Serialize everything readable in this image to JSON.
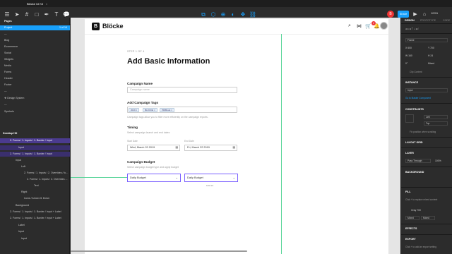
{
  "window": {
    "tab_title": "Blöcke UI Kit",
    "tab_close": "×"
  },
  "toolbar": {
    "user_initial": "B",
    "share_label": "Share",
    "zoom_label": "100%"
  },
  "left": {
    "pages_header": "Pages",
    "pages": [
      "Project",
      "—",
      "Blog",
      "Ecommerce",
      "Social",
      "Widgets",
      "Media",
      "Forms",
      "Header",
      "Footer",
      "—",
      "❖ Design System",
      "—",
      "Symbols"
    ],
    "project_count": "1 of 14",
    "layers": [
      "Desktop HD",
      "2. Forms / 1. Inputs / 1. Border / Input",
      "Input",
      "2. Forms / 1. Inputs / 1. Border / Input",
      "Input",
      "Left",
      "2. Forms / 1. Inputs / 2. Overrides / Ic...",
      "2. Forms / 1. Inputs / 2. Overrides ...",
      "Text",
      "Right",
      "Icons / Arrow #1 Down",
      "Background",
      "2. Forms / 1. Inputs / 1. Border / Input + Label",
      "2. Forms / 1. Inputs / 1. Border / Input + Label",
      "Label",
      "Input",
      "Input"
    ]
  },
  "app": {
    "brand": "Blöcke",
    "logo_letter": "B",
    "cart_count": "2",
    "step": "STEP 1 OF 4",
    "title": "Add Basic Information",
    "campaign_name_label": "Campaign Name",
    "campaign_name_placeholder": "Campaign name",
    "tags_label": "Add Campaign Tags",
    "tags": [
      "2019 ×",
      "BLOCKE ×",
      "PRIBLLE ×"
    ],
    "tags_hint": "Campaign tags allow you to filter more efficiently on the campaign reports.",
    "timing_label": "Timing",
    "timing_hint": "Select campaign launch and end dates",
    "start_label": "Start Date",
    "start_value": "Wed, March 20 2019",
    "end_label": "End Date",
    "end_value": "Fri, March 22 2019",
    "budget_label": "Campaign Budget",
    "budget_hint": "Select campaign budget type and apply budget",
    "budget_left": "Daily Budget",
    "budget_right": "Daily Budget",
    "dimension": "160×24"
  },
  "right": {
    "tabs": [
      "DESIGN",
      "PROTOTYPE",
      "CODE"
    ],
    "frame_label": "Frame",
    "x": "X 600",
    "y": "Y 700",
    "w": "W 160",
    "h": "H 24",
    "r": "0°",
    "mixed": "Mixed",
    "clip": "Clip Content",
    "instance_label": "INSTANCE",
    "instance_value": "Input",
    "goto_master": "Go to Master Component",
    "constraints_label": "CONSTRAINTS",
    "c_left": "Left",
    "c_top": "Top",
    "fix_scroll": "Fix position when scrolling",
    "layout_grid": "LAYOUT GRID",
    "layer_label": "LAYER",
    "blend": "Pass Through",
    "opacity": "100%",
    "background_label": "BACKGROUND",
    "fill_label": "FILL",
    "fill_hint": "Click + to replace mixed content",
    "gray": "Gray 700",
    "mixed2": "Mixed",
    "mixed3": "Mixed",
    "effects_label": "EFFECTS",
    "export_label": "EXPORT",
    "export_hint": "Click + to add an export setting"
  }
}
